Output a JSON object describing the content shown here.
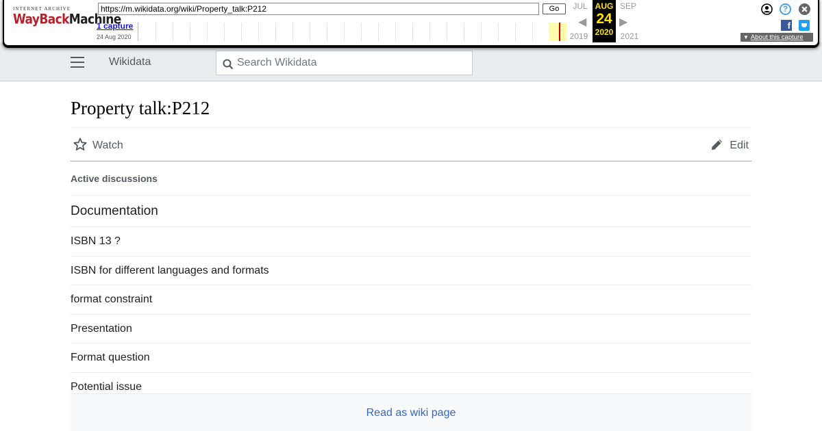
{
  "wayback": {
    "logo_top": "INTERNET ARCHIVE",
    "logo_part1": "WayBack",
    "logo_part2": "Machine",
    "url": "https://m.wikidata.org/wiki/Property_talk:P212",
    "go_label": "Go",
    "captures_label": "1 capture",
    "capture_date": "24 Aug 2020",
    "prev_month": "JUL",
    "current_month": "AUG",
    "next_month": "SEP",
    "current_day": "24",
    "prev_year": "2019",
    "current_year": "2020",
    "next_year": "2021",
    "about_label": "About this capture",
    "help_glyph": "?",
    "facebook_glyph": "f"
  },
  "header": {
    "site_name": "Wikidata",
    "search_placeholder": "Search Wikidata"
  },
  "page": {
    "title": "Property talk:P212",
    "watch_label": "Watch",
    "edit_label": "Edit",
    "active_discussions": "Active discussions",
    "section_heading": "Documentation",
    "topics": [
      "ISBN 13 ?",
      "ISBN for different languages and formats",
      "format constraint",
      "Presentation",
      "Format question",
      "Potential issue"
    ]
  },
  "footer": {
    "read_as_wiki": "Read as wiki page"
  },
  "colors": {
    "link": "#3366cc",
    "header_bg": "#eaecf0",
    "wayback_highlight": "#ffe400"
  }
}
